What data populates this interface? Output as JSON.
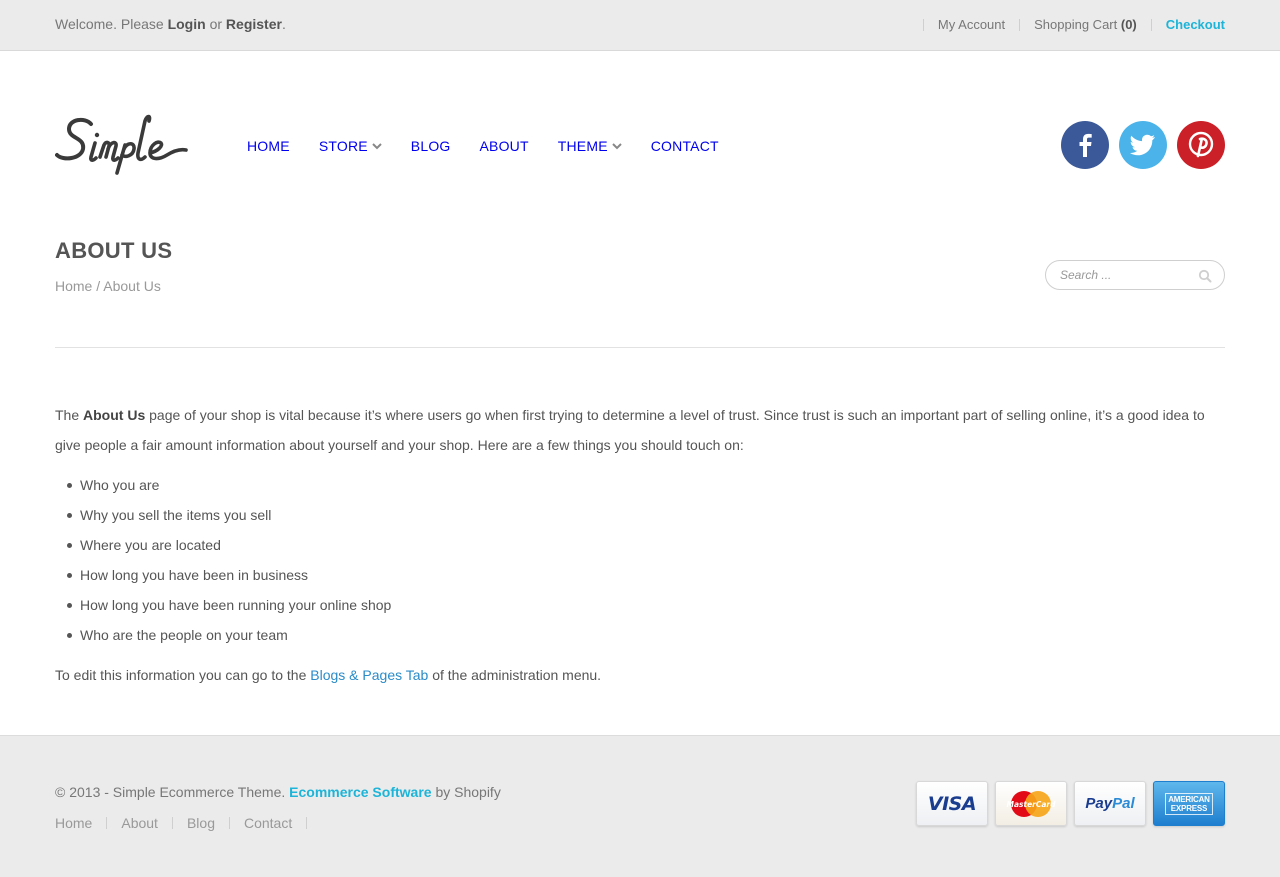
{
  "topbar": {
    "welcome_prefix": "Welcome. Please",
    "login": "Login",
    "or": "or",
    "register": "Register",
    "period": ".",
    "my_account": "My Account",
    "shopping_cart": "Shopping Cart",
    "cart_count": "(0)",
    "checkout": "Checkout"
  },
  "header": {
    "logo_text": "Simple",
    "nav": [
      {
        "label": "HOME"
      },
      {
        "label": "STORE"
      },
      {
        "label": "BLOG"
      },
      {
        "label": "ABOUT"
      },
      {
        "label": "THEME"
      },
      {
        "label": "CONTACT"
      }
    ],
    "social_icons": [
      "facebook-icon",
      "twitter-icon",
      "pinterest-icon"
    ]
  },
  "page": {
    "title": "ABOUT US",
    "breadcrumb_home": "Home",
    "breadcrumb_sep": "/",
    "breadcrumb_current": "About Us",
    "search_placeholder": "Search ..."
  },
  "content": {
    "intro_before": "The",
    "intro_bold": "About Us",
    "intro_after": "page of your shop is vital because it’s where users go when first trying to determine a level of trust. Since trust is such an important part of selling online, it’s a good idea to give people a fair amount information about yourself and your shop. Here are a few things you should touch on:",
    "bullets": [
      "Who you are",
      "Why you sell the items you sell",
      "Where you are located",
      "How long you have been in business",
      "How long you have been running your online shop",
      "Who are the people on your team"
    ],
    "edit_before": "To edit this information you can go to the",
    "edit_link": "Blogs & Pages Tab",
    "edit_after": "of the administration menu."
  },
  "footer": {
    "copyright": "© 2013 - Simple Ecommerce Theme.",
    "software_link": "Ecommerce Software",
    "by": "by Shopify",
    "links": [
      "Home",
      "About",
      "Blog",
      "Contact"
    ],
    "payments": {
      "visa": "VISA",
      "mastercard": "MasterCard",
      "paypal_pay": "Pay",
      "paypal_pal": "Pal",
      "amex_line1": "AMERICAN",
      "amex_line2": "EXPRESS"
    }
  },
  "colors": {
    "accent": "#1cb4d8",
    "link": "#2a8bc8",
    "facebook": "#3b5998",
    "twitter": "#4bb3e9",
    "pinterest": "#cb2027"
  }
}
